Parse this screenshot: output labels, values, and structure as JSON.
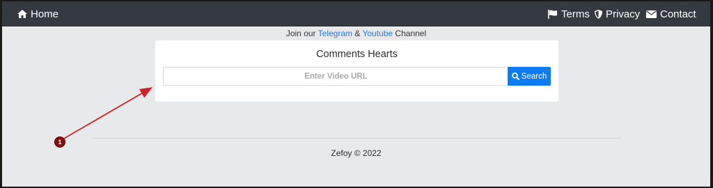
{
  "navbar": {
    "home_label": "Home",
    "terms_label": "Terms",
    "privacy_label": "Privacy",
    "contact_label": "Contact",
    "icons": [
      "home-icon",
      "flag-icon",
      "shield-icon",
      "envelope-icon"
    ],
    "background": "#343a40"
  },
  "join": {
    "prefix": "Join our ",
    "telegram": "Telegram",
    "amp": " & ",
    "youtube": "Youtube",
    "suffix": " Channel",
    "link_color": "#2a7ae2"
  },
  "card": {
    "title": "Comments Hearts",
    "input_placeholder": "Enter Video URL",
    "input_value": "",
    "search_label": "Search",
    "search_color": "#0d7bf3"
  },
  "footer": {
    "text": "Zefoy © 2022"
  },
  "annotation": {
    "marker_label": "1",
    "arrow_color": "#d0202a",
    "marker_color": "#8b0a0a"
  }
}
